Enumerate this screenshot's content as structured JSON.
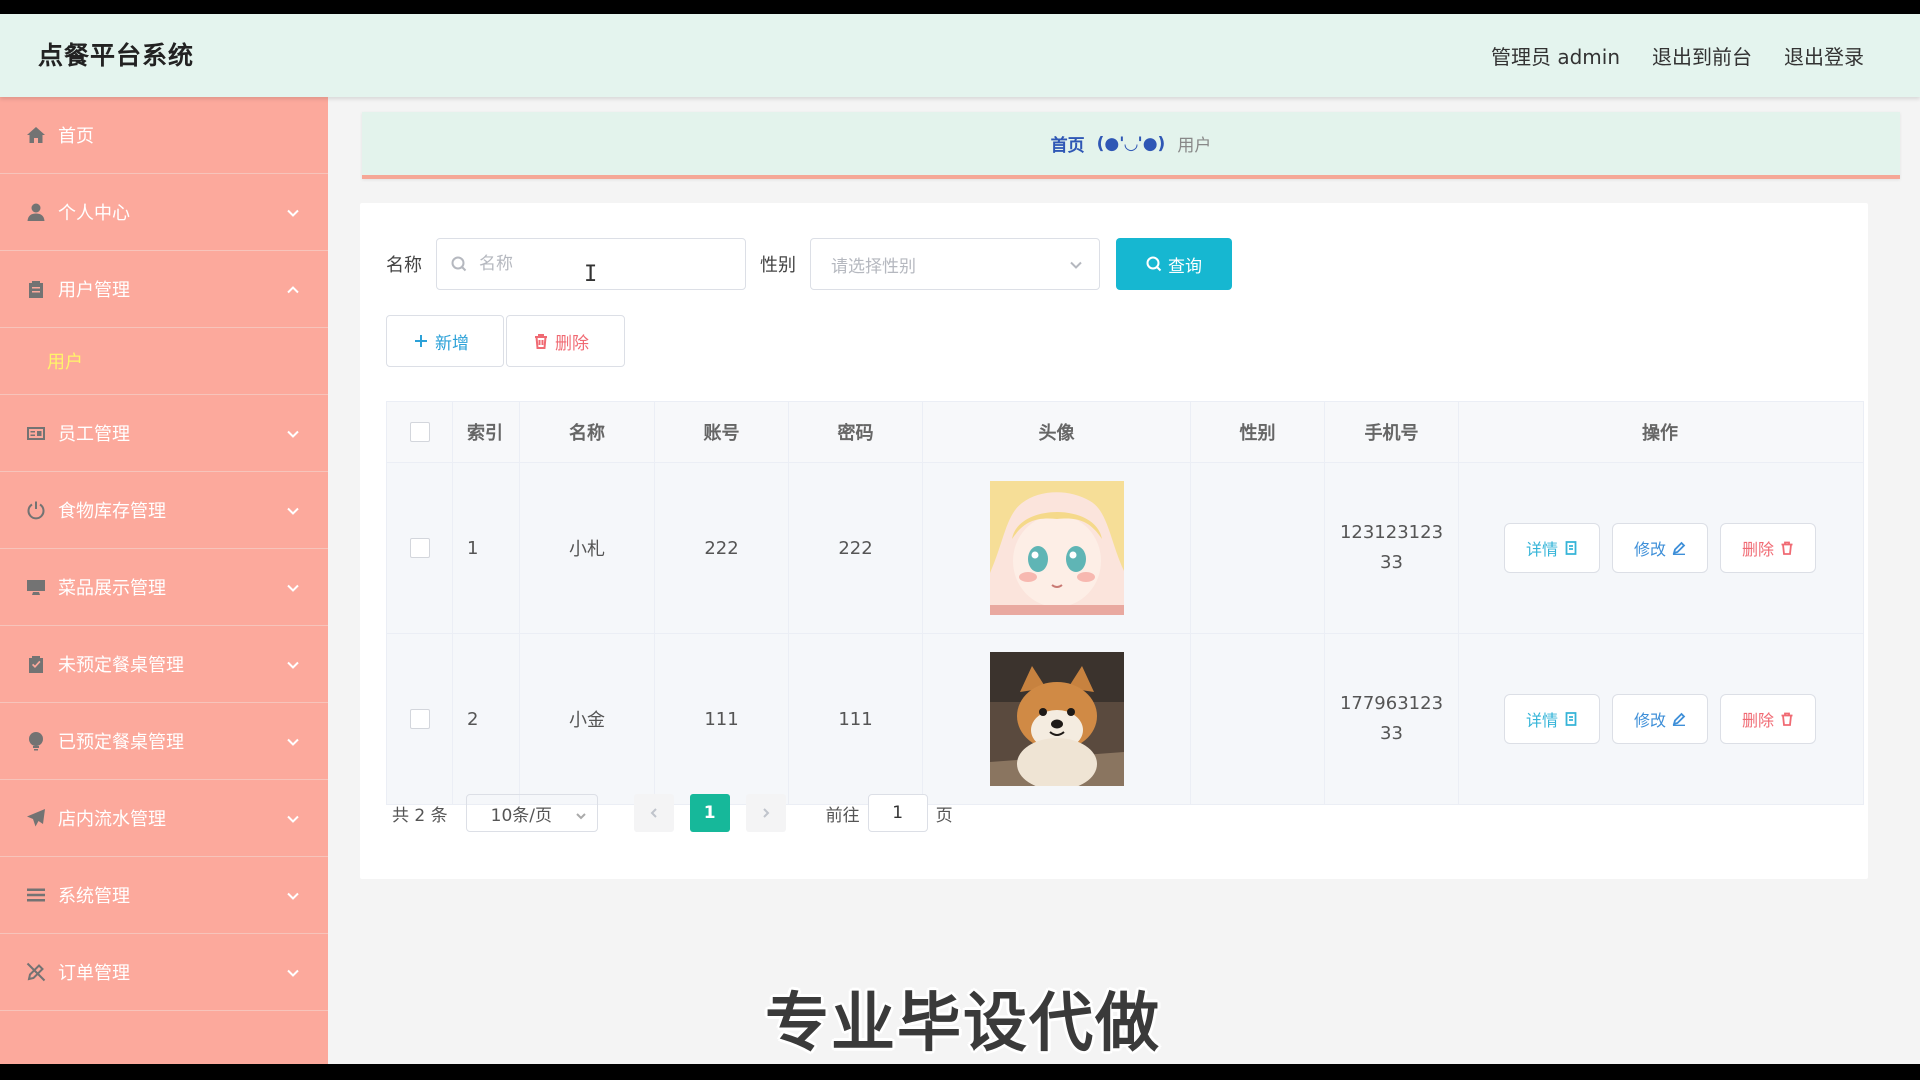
{
  "header": {
    "title": "点餐平台系统",
    "user_label": "管理员 admin",
    "front_link": "退出到前台",
    "logout_link": "退出登录"
  },
  "sidebar": {
    "items": [
      {
        "label": "首页",
        "icon": "home-icon"
      },
      {
        "label": "个人中心",
        "icon": "user-icon"
      },
      {
        "label": "用户管理",
        "icon": "clipboard-icon",
        "expanded": true
      },
      {
        "label": "员工管理",
        "icon": "id-card-icon"
      },
      {
        "label": "食物库存管理",
        "icon": "power-icon"
      },
      {
        "label": "菜品展示管理",
        "icon": "monitor-icon"
      },
      {
        "label": "未预定餐桌管理",
        "icon": "check-clipboard-icon"
      },
      {
        "label": "已预定餐桌管理",
        "icon": "bulb-icon"
      },
      {
        "label": "店内流水管理",
        "icon": "send-icon"
      },
      {
        "label": "系统管理",
        "icon": "menu-icon"
      },
      {
        "label": "订单管理",
        "icon": "edit-off-icon"
      }
    ],
    "sub_item": "用户"
  },
  "breadcrumb": {
    "home": "首页",
    "separator": "(●'◡'●)",
    "current": "用户"
  },
  "search": {
    "name_label": "名称",
    "name_placeholder": "名称",
    "sex_label": "性别",
    "sex_placeholder": "请选择性别",
    "query_button": "查询"
  },
  "actions": {
    "add_button": "新增",
    "delete_button": "删除"
  },
  "table": {
    "columns": [
      "索引",
      "名称",
      "账号",
      "密码",
      "头像",
      "性别",
      "手机号",
      "操作"
    ],
    "rows": [
      {
        "index": "1",
        "name": "小札",
        "account": "222",
        "password": "222",
        "avatar": "anime-girl-avatar",
        "sex": "",
        "phone": "12312312333"
      },
      {
        "index": "2",
        "name": "小金",
        "account": "111",
        "password": "111",
        "avatar": "shiba-dog-avatar",
        "sex": "",
        "phone": "17796312333"
      }
    ],
    "op_detail": "详情",
    "op_edit": "修改",
    "op_delete": "删除"
  },
  "pagination": {
    "total": "共 2 条",
    "page_size": "10条/页",
    "current_page": "1",
    "goto_label": "前往",
    "goto_value": "1",
    "page_suffix": "页"
  },
  "watermark": "专业毕设代做",
  "colors": {
    "topbar": "#e4f4ee",
    "sidebar": "#fca99c",
    "query_button": "#16b7d1",
    "active_page": "#16b89a",
    "active_sub_item": "#fff46a"
  }
}
